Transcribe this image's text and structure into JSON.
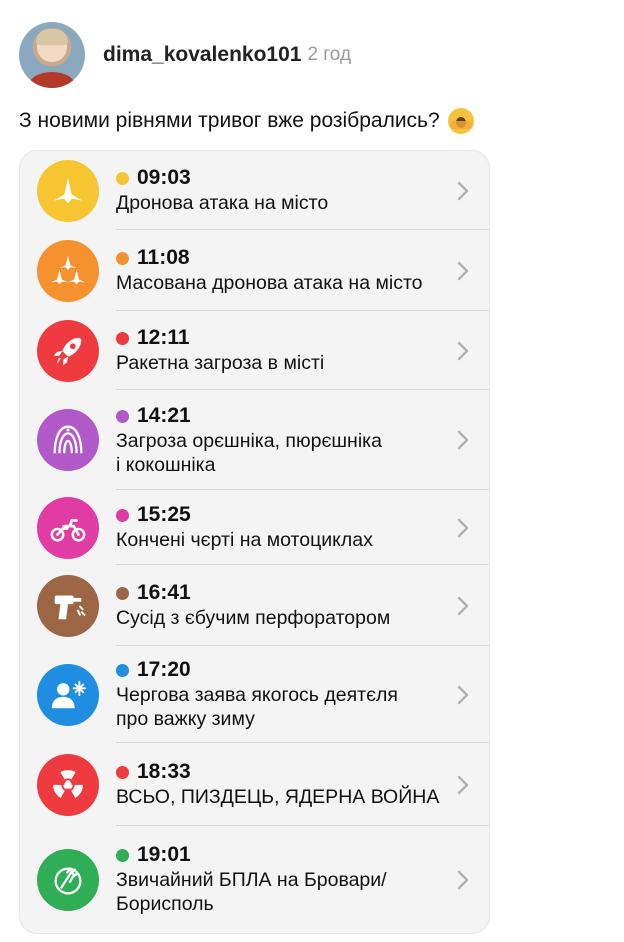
{
  "post": {
    "username": "dima_kovalenko101",
    "time": "2 год",
    "text": "З новими рівнями тривог вже розібрались?",
    "emoji": "face-with-open-eyes-and-hand-over-mouth-icon"
  },
  "alerts": [
    {
      "time": "09:03",
      "line1": "Дронова атака на місто",
      "line2": "",
      "color": "#f6c531",
      "icon": "drone-icon"
    },
    {
      "time": "11:08",
      "line1": "Масована дронова атака на місто",
      "line2": "",
      "color": "#f5922f",
      "icon": "drones-swarm-icon"
    },
    {
      "time": "12:11",
      "line1": "Ракетна загроза в місті",
      "line2": "",
      "color": "#ef3a3f",
      "icon": "rocket-icon"
    },
    {
      "time": "14:21",
      "line1": "Загроза орєшніка, пюрєшніка",
      "line2": "і кокошніка",
      "color": "#b259c9",
      "icon": "kokoshnik-icon"
    },
    {
      "time": "15:25",
      "line1": "Кончені чєрті на мотоциклах",
      "line2": "",
      "color": "#e13ba4",
      "icon": "motorcycle-icon"
    },
    {
      "time": "16:41",
      "line1": "Сусід з єбучим перфоратором",
      "line2": "",
      "color": "#9c6644",
      "icon": "drill-icon"
    },
    {
      "time": "17:20",
      "line1": "Чергова заява якогось деятєля",
      "line2": "про важку зиму",
      "color": "#1f8ee0",
      "icon": "person-snowflake-icon"
    },
    {
      "time": "18:33",
      "line1": "ВСЬО, ПИЗДЕЦЬ, ЯДЕРНА ВОЙНА",
      "line2": "",
      "color": "#ef3a3f",
      "icon": "radiation-icon"
    },
    {
      "time": "19:01",
      "line1": "Звичайний БПЛА на Бровари/",
      "line2": "Борисполь",
      "color": "#2fae55",
      "icon": "facepalm-icon"
    }
  ]
}
